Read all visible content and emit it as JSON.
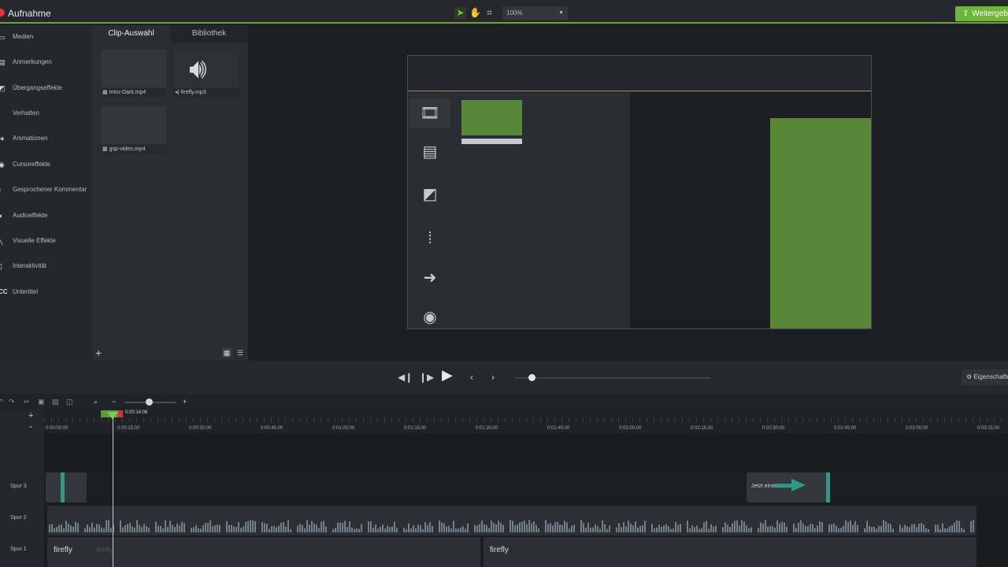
{
  "app": {
    "title": "Aufnahme"
  },
  "toolbar": {
    "zoom_value": "100%",
    "share_label": "Weitergeben"
  },
  "sidebar": {
    "items": [
      {
        "label": "Medien",
        "icon": "media-icon"
      },
      {
        "label": "Anmerkungen",
        "icon": "annotation-icon"
      },
      {
        "label": "Übergangseffekte",
        "icon": "transition-icon"
      },
      {
        "label": "Verhalten",
        "icon": "behavior-icon"
      },
      {
        "label": "Animationen",
        "icon": "animation-icon"
      },
      {
        "label": "Cursoreffekte",
        "icon": "cursor-icon"
      },
      {
        "label": "Gesprochener Kommentar",
        "icon": "microphone-icon"
      },
      {
        "label": "Audioeffekte",
        "icon": "audio-icon"
      },
      {
        "label": "Visuelle Effekte",
        "icon": "wand-icon"
      },
      {
        "label": "Interaktivität",
        "icon": "interactivity-icon"
      },
      {
        "label": "Untertitel",
        "icon": "captions-icon"
      }
    ]
  },
  "media_panel": {
    "tabs": [
      "Clip-Auswahl",
      "Bibliothek"
    ],
    "clips": [
      {
        "name": "Intro-Dark.mp4",
        "kind": "video"
      },
      {
        "name": "firefly.mp3",
        "kind": "audio"
      },
      {
        "name": "gsp-video.mp4",
        "kind": "video"
      }
    ]
  },
  "playback": {
    "properties_label": "Eigenschaften",
    "position_fraction": 0.08
  },
  "timeline": {
    "playhead_time": "0:00:14;06",
    "ruler_labels": [
      "0:00:00;00",
      "0:00:15;00",
      "0:00:30;00",
      "0:00:45;00",
      "0:01:00;00",
      "0:01:15;00",
      "0:01:30;00",
      "0:01:45;00",
      "0:02:00;00",
      "0:02:15;00",
      "0:02:30;00",
      "0:02:45;00",
      "0:03:00;00",
      "0:03:15;00"
    ],
    "tracks": [
      {
        "name": "Spur 3",
        "clips": [
          "",
          "Jetzt eine"
        ]
      },
      {
        "name": "Spur 2",
        "clips": []
      },
      {
        "name": "Spur 1",
        "clips": [
          "firefly",
          "firefly"
        ]
      }
    ]
  },
  "colors": {
    "accent_green": "#6fb53c",
    "record_red": "#e0343a",
    "teal": "#2b9c8c"
  }
}
